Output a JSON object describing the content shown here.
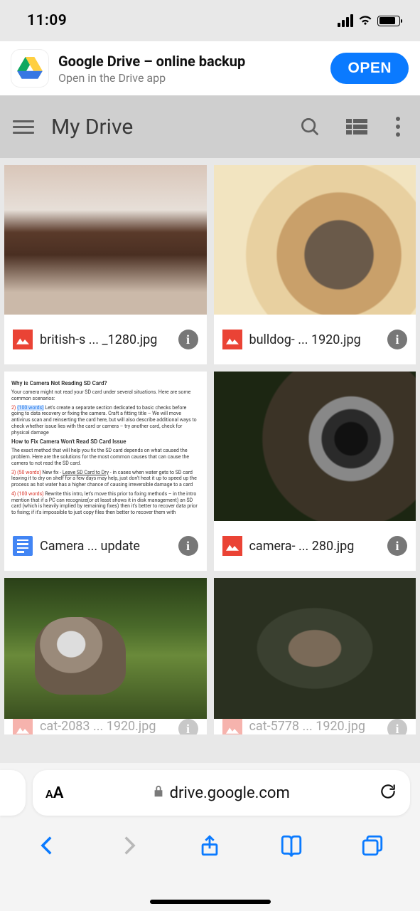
{
  "status": {
    "time": "11:09"
  },
  "banner": {
    "title": "Google Drive – online backup",
    "subtitle": "Open in the Drive app",
    "button": "OPEN"
  },
  "toolbar": {
    "title": "My Drive"
  },
  "files": [
    {
      "name": "british-s ... _1280.jpg",
      "type": "image"
    },
    {
      "name": "bulldog- ... 1920.jpg",
      "type": "image"
    },
    {
      "name": "Camera ... update",
      "type": "doc"
    },
    {
      "name": "camera- ... 280.jpg",
      "type": "image"
    },
    {
      "name": "cat-2083 ... 1920.jpg",
      "type": "image"
    },
    {
      "name": "cat-5778 ... 1920.jpg",
      "type": "image"
    }
  ],
  "doc_preview": {
    "h1": "Why is Camera Not Reading SD Card?",
    "p1": "Your camera might not read your SD card under several situations. Here are some common scenarios:",
    "n2": "2)",
    "n2_hl": "(100 words)",
    "n2_text": " Let's create a separate section dedicated to basic checks before going to data recovery or fixing the camera. Craft a fitting title – We will move antivirus scan and reinserting the card here, but will also describe additional ways to check whether issue lies with the card or camera – try another card, check for physical damage",
    "h2": "How to Fix Camera Won't Read SD Card Issue",
    "p2": "The exact method that will help you fix the SD card depends on what caused the problem. Here are the solutions for the most common causes that can cause the camera to not read the SD card.",
    "n3": "3)",
    "n3_hl": "(50 words)",
    "n3_lead": " New fix - ",
    "n3_u": "Leave SD Card to Dry",
    "n3_text": " - in cases when water gets to SD card leaving it to dry on shelf for a few days may help, just don't heat it up to speed up the process as hot water has a higher chance of causing irreversible damage to a card",
    "n4": "4)",
    "n4_hl": "(100 words)",
    "n4_lead": " Rewrite this intro, let's move this prior to fixing methods – in the intro mention that if a PC can recognize(or at least shows it in disk management) an SD card (which is heavily implied by remaining fixes) then it's better to recover data prior to fixing; if it's impossible to just copy files then better to recover them with"
  },
  "browser": {
    "url": "drive.google.com",
    "aa_small": "A",
    "aa_large": "A"
  }
}
